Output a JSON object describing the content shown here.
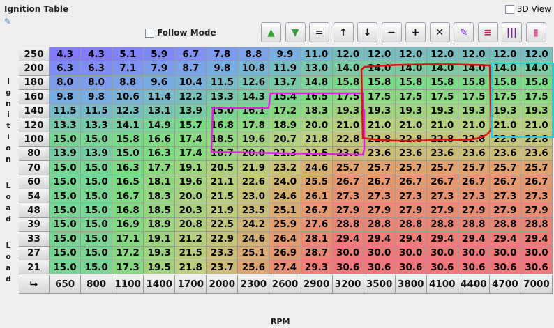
{
  "window": {
    "title": "Ignition Table",
    "view3d_label": "3D View"
  },
  "toolbar": {
    "follow_mode_label": "Follow Mode",
    "buttons": [
      {
        "name": "increase-green-button",
        "glyph": "▲",
        "color": "#3aa13a"
      },
      {
        "name": "decrease-green-button",
        "glyph": "▼",
        "color": "#3aa13a"
      },
      {
        "name": "equal-button",
        "glyph": "=",
        "color": "#111111"
      },
      {
        "name": "arrow-up-button",
        "glyph": "↑",
        "color": "#111111"
      },
      {
        "name": "arrow-down-button",
        "glyph": "↓",
        "color": "#111111"
      },
      {
        "name": "minus-button",
        "glyph": "−",
        "color": "#111111"
      },
      {
        "name": "plus-button",
        "glyph": "+",
        "color": "#111111"
      },
      {
        "name": "multiply-button",
        "glyph": "✕",
        "color": "#111111"
      },
      {
        "name": "pen-button",
        "glyph": "✎",
        "color": "#8a2be2"
      },
      {
        "name": "rows-button",
        "glyph": "≡",
        "color": "#c02050"
      },
      {
        "name": "columns-button",
        "glyph": "|||",
        "color": "#7020a0"
      },
      {
        "name": "gradient-button",
        "glyph": "▮",
        "color": "#e060a0"
      }
    ]
  },
  "axes": {
    "y_label": "Ignition Load Load",
    "x_label": "RPM",
    "corner_icon": "corner-arrow-icon"
  },
  "table": {
    "rpm": [
      "650",
      "800",
      "1100",
      "1400",
      "1700",
      "2000",
      "2300",
      "2600",
      "2900",
      "3200",
      "3500",
      "3800",
      "4100",
      "4400",
      "4700",
      "7000"
    ],
    "load": [
      "250",
      "200",
      "180",
      "160",
      "140",
      "120",
      "100",
      "80",
      "70",
      "60",
      "54",
      "48",
      "39",
      "33",
      "27",
      "21"
    ],
    "values": [
      [
        "4.3",
        "4.3",
        "5.1",
        "5.9",
        "6.7",
        "7.8",
        "8.8",
        "9.9",
        "11.0",
        "12.0",
        "12.0",
        "12.0",
        "12.0",
        "12.0",
        "12.0",
        "12.0"
      ],
      [
        "6.3",
        "6.3",
        "7.1",
        "7.9",
        "8.7",
        "9.8",
        "10.8",
        "11.9",
        "13.0",
        "14.0",
        "14.0",
        "14.0",
        "14.0",
        "14.0",
        "14.0",
        "14.0"
      ],
      [
        "8.0",
        "8.0",
        "8.8",
        "9.6",
        "10.4",
        "11.5",
        "12.6",
        "13.7",
        "14.8",
        "15.8",
        "15.8",
        "15.8",
        "15.8",
        "15.8",
        "15.8",
        "15.8"
      ],
      [
        "9.8",
        "9.8",
        "10.6",
        "11.4",
        "12.2",
        "13.3",
        "14.3",
        "15.4",
        "16.5",
        "17.5",
        "17.5",
        "17.5",
        "17.5",
        "17.5",
        "17.5",
        "17.5"
      ],
      [
        "11.5",
        "11.5",
        "12.3",
        "13.1",
        "13.9",
        "15.0",
        "16.1",
        "17.2",
        "18.3",
        "19.3",
        "19.3",
        "19.3",
        "19.3",
        "19.3",
        "19.3",
        "19.3"
      ],
      [
        "13.3",
        "13.3",
        "14.1",
        "14.9",
        "15.7",
        "16.8",
        "17.8",
        "18.9",
        "20.0",
        "21.0",
        "21.0",
        "21.0",
        "21.0",
        "21.0",
        "21.0",
        "21.0"
      ],
      [
        "15.0",
        "15.0",
        "15.8",
        "16.6",
        "17.4",
        "18.5",
        "19.6",
        "20.7",
        "21.8",
        "22.8",
        "22.8",
        "22.8",
        "22.8",
        "22.8",
        "22.8",
        "22.8"
      ],
      [
        "13.9",
        "13.9",
        "15.0",
        "16.3",
        "17.4",
        "18.7",
        "20.0",
        "21.3",
        "22.5",
        "23.6",
        "23.6",
        "23.6",
        "23.6",
        "23.6",
        "23.6",
        "23.6"
      ],
      [
        "15.0",
        "15.0",
        "16.3",
        "17.7",
        "19.1",
        "20.5",
        "21.9",
        "23.2",
        "24.6",
        "25.7",
        "25.7",
        "25.7",
        "25.7",
        "25.7",
        "25.7",
        "25.7"
      ],
      [
        "15.0",
        "15.0",
        "16.5",
        "18.1",
        "19.6",
        "21.1",
        "22.6",
        "24.0",
        "25.5",
        "26.7",
        "26.7",
        "26.7",
        "26.7",
        "26.7",
        "26.7",
        "26.7"
      ],
      [
        "15.0",
        "15.0",
        "16.7",
        "18.3",
        "20.0",
        "21.5",
        "23.0",
        "24.6",
        "26.1",
        "27.3",
        "27.3",
        "27.3",
        "27.3",
        "27.3",
        "27.3",
        "27.3"
      ],
      [
        "15.0",
        "15.0",
        "16.8",
        "18.5",
        "20.3",
        "21.9",
        "23.5",
        "25.1",
        "26.7",
        "27.9",
        "27.9",
        "27.9",
        "27.9",
        "27.9",
        "27.9",
        "27.9"
      ],
      [
        "15.0",
        "15.0",
        "16.9",
        "18.9",
        "20.8",
        "22.5",
        "24.2",
        "25.9",
        "27.6",
        "28.8",
        "28.8",
        "28.8",
        "28.8",
        "28.8",
        "28.8",
        "28.8"
      ],
      [
        "15.0",
        "15.0",
        "17.1",
        "19.1",
        "21.2",
        "22.9",
        "24.6",
        "26.4",
        "28.1",
        "29.4",
        "29.4",
        "29.4",
        "29.4",
        "29.4",
        "29.4",
        "29.4"
      ],
      [
        "15.0",
        "15.0",
        "17.2",
        "19.3",
        "21.5",
        "23.3",
        "25.1",
        "26.9",
        "28.7",
        "30.0",
        "30.0",
        "30.0",
        "30.0",
        "30.0",
        "30.0",
        "30.0"
      ],
      [
        "15.0",
        "15.0",
        "17.3",
        "19.5",
        "21.8",
        "23.7",
        "25.6",
        "27.4",
        "29.3",
        "30.6",
        "30.6",
        "30.6",
        "30.6",
        "30.6",
        "30.6",
        "30.6"
      ]
    ]
  },
  "annotation_colors": {
    "magenta": "#e020e0",
    "red": "#e01010",
    "cyan": "#20d0e0"
  }
}
